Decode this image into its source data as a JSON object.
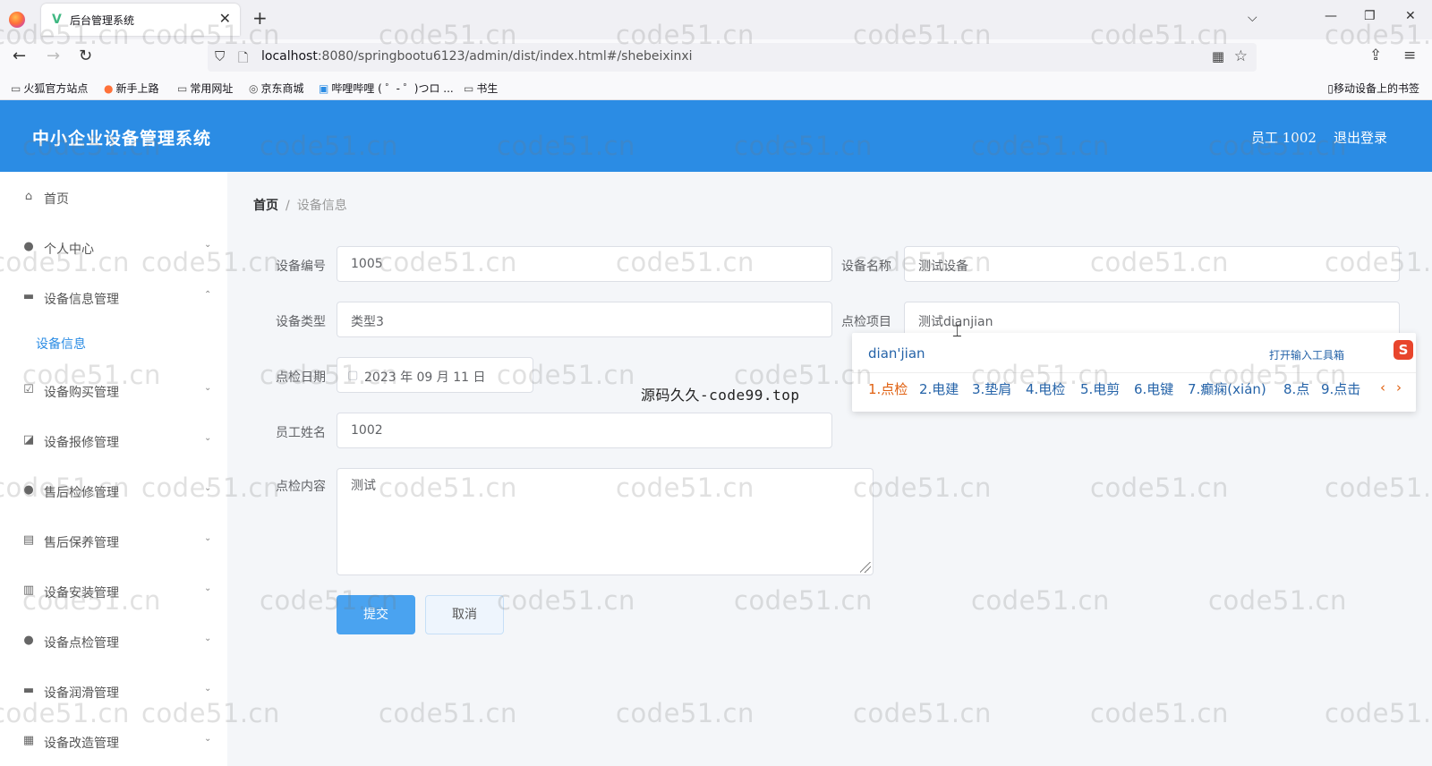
{
  "browser": {
    "tab_title": "后台管理系统",
    "tab_close": "✕",
    "new_tab": "+",
    "url_host": "localhost",
    "url_rest": ":8080/springbootu6123/admin/dist/index.html#/shebeixinxi",
    "bookmarks": [
      "火狐官方站点",
      "新手上路",
      "常用网址",
      "京东商城",
      "哔哩哔哩 ( ゜- ゜)つロ ...",
      "书生"
    ],
    "mobile_bookmarks": "移动设备上的书签"
  },
  "header": {
    "title": "中小企业设备管理系统",
    "user": "员工 1002",
    "logout": "退出登录"
  },
  "sidebar": {
    "items": [
      {
        "label": "首页",
        "icon": "home-icon",
        "chevron": false
      },
      {
        "label": "个人中心",
        "icon": "user-icon",
        "chevron": true
      },
      {
        "label": "设备信息管理",
        "icon": "briefcase-icon",
        "chevron": true,
        "expanded": true
      },
      {
        "label": "设备购买管理",
        "icon": "check-square-icon",
        "chevron": true
      },
      {
        "label": "设备报修管理",
        "icon": "chart-icon",
        "chevron": true
      },
      {
        "label": "售后检修管理",
        "icon": "user-icon",
        "chevron": true
      },
      {
        "label": "售后保养管理",
        "icon": "clipboard-icon",
        "chevron": true
      },
      {
        "label": "设备安装管理",
        "icon": "bar-chart-icon",
        "chevron": true
      },
      {
        "label": "设备点检管理",
        "icon": "bulb-icon",
        "chevron": true
      },
      {
        "label": "设备润滑管理",
        "icon": "monitor-icon",
        "chevron": true
      },
      {
        "label": "设备改造管理",
        "icon": "grid-icon",
        "chevron": true
      }
    ],
    "submenu": "设备信息"
  },
  "breadcrumb": {
    "home": "首页",
    "sep": "/",
    "current": "设备信息"
  },
  "form": {
    "code_label": "设备编号",
    "code_value": "1005",
    "name_label": "设备名称",
    "name_value": "测试设备",
    "type_label": "设备类型",
    "type_value": "类型3",
    "item_label": "点检项目",
    "item_value": "测试dianjian",
    "date_label": "点检日期",
    "date_value": "2023 年 09 月 11 日",
    "staff_label": "员工姓名",
    "staff_value": "1002",
    "content_label": "点检内容",
    "content_value": "测试",
    "submit": "提交",
    "cancel": "取消"
  },
  "ime": {
    "composition": "dian'jian",
    "toolbox": "打开输入工具箱",
    "logo": "S",
    "candidates": [
      "1.点检",
      "2.电建",
      "3.垫肩",
      "4.电检",
      "5.电剪",
      "6.电键",
      "7.癫痫(xián)",
      "8.点",
      "9.点击"
    ],
    "prev": "‹",
    "next": "›"
  },
  "overlay": "源码久久-code99.top",
  "watermark": "code51.cn"
}
